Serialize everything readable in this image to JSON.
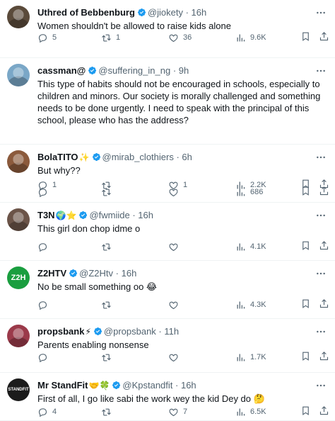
{
  "tweets": [
    {
      "name": "Uthred of Bebbenburg",
      "emoji": "",
      "handle": "@jiokety",
      "time": "16h",
      "text": "Women shouldn't be allowed to raise kids alone",
      "replies": "5",
      "retweets": "1",
      "likes": "36",
      "views": "9.6K",
      "avatar_color": "#5a4a3a"
    },
    {
      "name": "cassman@",
      "emoji": "",
      "handle": "@suffering_in_ng",
      "time": "9h",
      "text": "This type of habits should not be encouraged in schools, especially to children and minors. Our society is morally challenged and something needs to be done urgently. I need to speak with the principal of this school, please who has the address?",
      "replies": "1",
      "retweets": "",
      "likes": "1",
      "views": "2.2K",
      "avatar_color": "#7aa7c7"
    },
    {
      "name": "BolaTITO",
      "emoji": "✨",
      "handle": "@mirab_clothiers",
      "time": "6h",
      "text": "But why??",
      "replies": "",
      "retweets": "",
      "likes": "",
      "views": "686",
      "avatar_color": "#8b5a3c"
    },
    {
      "name": "T3N",
      "emoji": "🌍⭐",
      "handle": "@fwmiide",
      "time": "16h",
      "text": "This girl don chop idme o",
      "replies": "",
      "retweets": "",
      "likes": "",
      "views": "4.1K",
      "avatar_color": "#6b5448"
    },
    {
      "name": "Z2HTV",
      "emoji": "",
      "handle": "@Z2Htv",
      "time": "16h",
      "text": "No be small something oo 😂",
      "replies": "",
      "retweets": "",
      "likes": "",
      "views": "4.3K",
      "avatar_color": "#1a9e3f",
      "avatar_text": "Z2H"
    },
    {
      "name": "propsbank",
      "emoji": "⚡",
      "handle": "@propsbank",
      "time": "11h",
      "text": "Parents enabling nonsense",
      "replies": "",
      "retweets": "",
      "likes": "",
      "views": "1.7K",
      "avatar_color": "#9b3a4a"
    },
    {
      "name": "Mr StandFit",
      "emoji": "🤝🍀",
      "handle": "@Kpstandfit",
      "time": "16h",
      "text": "First of all, I go like sabi the work wey the kid Dey do 🤔",
      "replies": "4",
      "retweets": "",
      "likes": "7",
      "views": "6.5K",
      "avatar_color": "#1b1b1b",
      "avatar_text": "STANDFIT"
    }
  ],
  "colors": {
    "verified": "#1d9bf0",
    "muted": "#536471"
  }
}
